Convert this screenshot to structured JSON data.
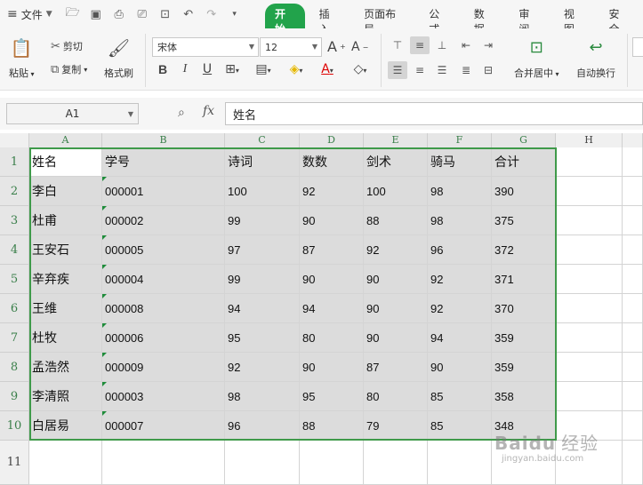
{
  "menu": {
    "file_label": "文件",
    "tabs": [
      {
        "label": "开始",
        "active": true
      },
      {
        "label": "插入",
        "active": false
      },
      {
        "label": "页面布局",
        "active": false
      },
      {
        "label": "公式",
        "active": false
      },
      {
        "label": "数据",
        "active": false
      },
      {
        "label": "审阅",
        "active": false
      },
      {
        "label": "视图",
        "active": false
      },
      {
        "label": "安全",
        "active": false
      }
    ],
    "accent_color": "#22a34b"
  },
  "ribbon": {
    "paste_label": "粘贴",
    "cut_label": "剪切",
    "copy_label": "复制",
    "format_painter_label": "格式刷",
    "font_name": "宋体",
    "font_size": "12",
    "merge_center_label": "合并居中",
    "wrap_text_label": "自动换行"
  },
  "formula_bar": {
    "name_box": "A1",
    "fx_label": "fx",
    "content": "姓名"
  },
  "sheet": {
    "columns": [
      "A",
      "B",
      "C",
      "D",
      "E",
      "F",
      "G",
      "H"
    ],
    "row_numbers": [
      "1",
      "2",
      "3",
      "4",
      "5",
      "6",
      "7",
      "8",
      "9",
      "10",
      "11"
    ],
    "rows": [
      [
        "姓名",
        "学号",
        "诗词",
        "数数",
        "剑术",
        "骑马",
        "合计"
      ],
      [
        "李白",
        "000001",
        "100",
        "92",
        "100",
        "98",
        "390"
      ],
      [
        "杜甫",
        "000002",
        "99",
        "90",
        "88",
        "98",
        "375"
      ],
      [
        "王安石",
        "000005",
        "97",
        "87",
        "92",
        "96",
        "372"
      ],
      [
        "辛弃疾",
        "000004",
        "99",
        "90",
        "90",
        "92",
        "371"
      ],
      [
        "王维",
        "000008",
        "94",
        "94",
        "90",
        "92",
        "370"
      ],
      [
        "杜牧",
        "000006",
        "95",
        "80",
        "90",
        "94",
        "359"
      ],
      [
        "孟浩然",
        "000009",
        "92",
        "90",
        "87",
        "90",
        "359"
      ],
      [
        "李清照",
        "000003",
        "98",
        "95",
        "80",
        "85",
        "358"
      ],
      [
        "白居易",
        "000007",
        "96",
        "88",
        "79",
        "85",
        "348"
      ]
    ],
    "selected_range": "A1:G10",
    "selection_color": "#3f9a4a"
  },
  "watermark": {
    "logo_text": "Baidu",
    "logo_suffix": "经验",
    "url": "jingyan.baidu.com"
  }
}
